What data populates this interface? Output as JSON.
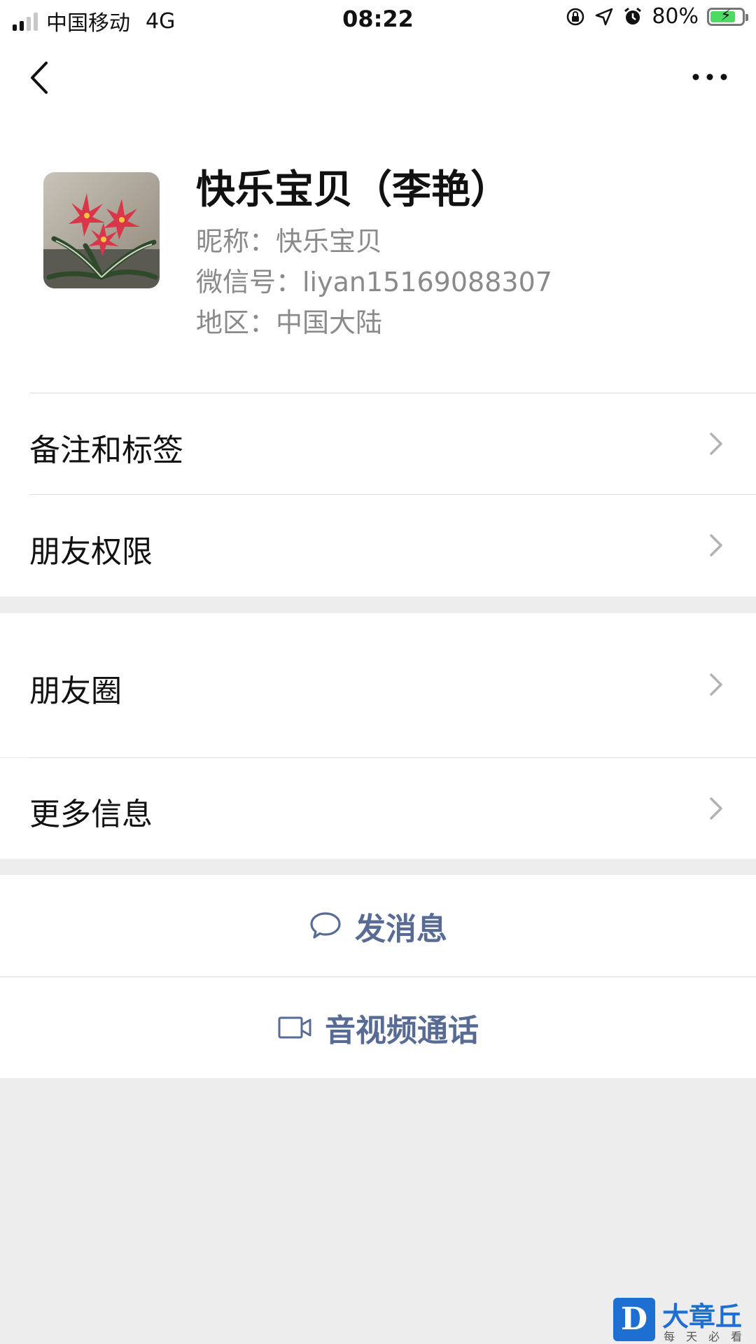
{
  "status_bar": {
    "carrier": "中国移动",
    "network": "4G",
    "time": "08:22",
    "battery": "80%",
    "battery_level": 0.8,
    "icons": [
      "orientation-lock-icon",
      "location-icon",
      "alarm-icon",
      "battery-charging-icon"
    ]
  },
  "navbar": {
    "back_icon": "chevron-left-icon",
    "more_icon": "more-dots-icon"
  },
  "profile": {
    "name": "快乐宝贝（李艳）",
    "nickname": "昵称：快乐宝贝",
    "wechat_id": "微信号：liyan15169088307",
    "region": "地区：中国大陆",
    "avatar": "avatar-image"
  },
  "section1": {
    "items": [
      {
        "label": "备注和标签"
      },
      {
        "label": "朋友权限"
      }
    ]
  },
  "section2": {
    "items": [
      {
        "label": "朋友圈"
      },
      {
        "label": "更多信息"
      }
    ]
  },
  "actions": {
    "message": "发消息",
    "call": "音视频通话"
  },
  "watermark": {
    "logo_letter": "D",
    "brand": "大章丘",
    "slogan": "每天必看"
  },
  "colors": {
    "link": "#576b95",
    "background": "#ededed",
    "battery_fill": "#4cd964"
  }
}
